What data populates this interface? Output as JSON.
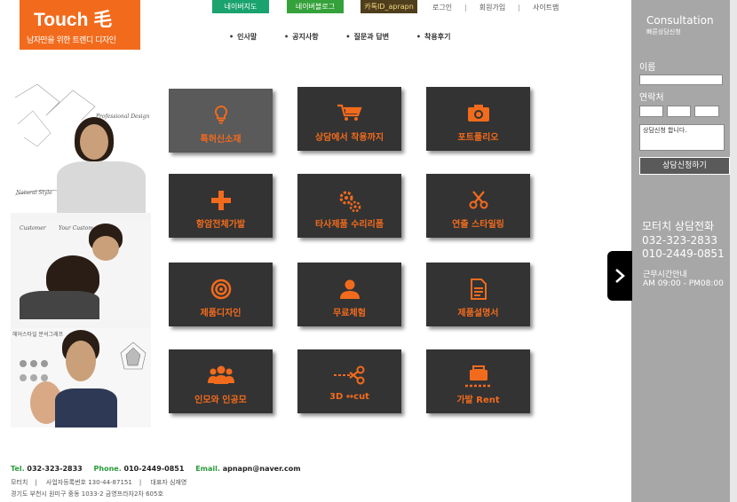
{
  "logo": {
    "title": "Touch 毛",
    "tagline": "남자만을 위한 트렌디 디자인"
  },
  "top_buttons": [
    "네이버지도",
    "네이버블로그",
    "카톡ID_aprapn"
  ],
  "top_links": [
    "로그인",
    "회원가입",
    "사이트맵"
  ],
  "menu": [
    "인사말",
    "공지사항",
    "질문과 답변",
    "착용후기"
  ],
  "photo_text": {
    "professional": "Professional Design",
    "natural": "Natural Style",
    "customer": "Customer",
    "custom": "Your Custom",
    "analysis": "헤어스타일 분석그래프"
  },
  "tiles": [
    {
      "label": "특허신소재",
      "icon": "lightbulb-icon"
    },
    {
      "label": "상담에서 착용까지",
      "icon": "cart-icon"
    },
    {
      "label": "포트폴리오",
      "icon": "camera-icon"
    },
    {
      "label": "항암전체가발",
      "icon": "plus-icon"
    },
    {
      "label": "타사제품 수리리폼",
      "icon": "gears-icon"
    },
    {
      "label": "연출 스타일링",
      "icon": "scissors-icon"
    },
    {
      "label": "제품디자인",
      "icon": "target-icon"
    },
    {
      "label": "무료체험",
      "icon": "user-icon"
    },
    {
      "label": "제품설명서",
      "icon": "document-icon"
    },
    {
      "label": "인모와 인공모",
      "icon": "group-icon"
    },
    {
      "label": "3D ↔cut",
      "icon": "cut-line-icon"
    },
    {
      "label": "가발 Rent",
      "icon": "briefcase-icon"
    }
  ],
  "sidebar": {
    "title": "Consultation",
    "subtitle": "빠른상담신청",
    "name_label": "이름",
    "phone_label": "연락처",
    "message_value": "상담신청 합니다.",
    "submit_label": "상담신청하기",
    "call_title": "모터치 상담전화",
    "phone1": "032-323-2833",
    "phone2": "010-2449-0851",
    "hours_title": "근무시간안내",
    "hours": "AM 09:00 - PM08:00"
  },
  "footer": {
    "tel_label": "Tel.",
    "tel": "032-323-2833",
    "phone_label": "Phone.",
    "phone": "010-2449-0851",
    "email_label": "Email.",
    "email": "apnapn@naver.com",
    "company": "모터치",
    "biz_no": "사업자등록번호 130-44-87151",
    "ceo": "대표자 심재영",
    "address": "경기도 부천시 원미구 중동 1033-2 금영프라자2차 605호"
  },
  "colors": {
    "accent": "#f26b1d",
    "tile": "#333333",
    "tile_active": "#5a5a5a",
    "sidebar": "#a7a7a7"
  }
}
